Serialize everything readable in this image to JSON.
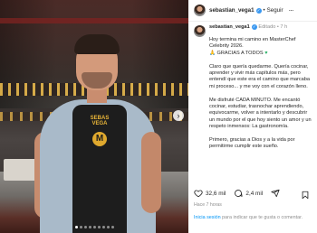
{
  "post": {
    "username": "sebastian_vega1",
    "follow_label": "Seguir",
    "separator": "•",
    "edited_label": "Editado",
    "time_ago": "7 h",
    "apron_text": "SEBAS VEGA",
    "apron_logo": "M",
    "caption": [
      "Hoy termina mi camino en MasterChef Celebrity 2026.",
      "GRACIAS A TODOS",
      "Claro que quería quedarme. Quería cocinar, aprender y vivir más capítulos más, pero entendí que este era el camino que marcaba mi proceso... y me voy con el corazón lleno.",
      "Me disfruté CADA MINUTO. Me encantó cocinar, estudiar, trasnochar aprendiendo, equivocarme, volver a intentarlo y descubrir un mundo por el que hoy siento un amor y un respeto inmensos: La gastronomía.",
      "Primero, gracias a Dios y a la vida por permitirme cumplir este sueño."
    ],
    "likes_count": "32,6 mil",
    "comments_count": "2,4 mil",
    "date": "Hace 7 horas",
    "login_link": "Inicia sesión",
    "login_rest": " para indicar que te gusta o comentar."
  },
  "icons": {
    "verified": "verified-badge-icon",
    "more": "more-options-icon",
    "like": "heart-icon",
    "comment": "comment-bubble-icon",
    "share": "paper-plane-share-icon",
    "save": "bookmark-icon",
    "next": "chevron-right-icon",
    "heart_green": "green-heart-emoji",
    "heart_red": "red-heart-emoji",
    "folded_hands": "folded-hands-emoji"
  },
  "colors": {
    "verified": "#3897f0",
    "link": "#0095f6",
    "muted": "#8e8e8e",
    "text": "#262626"
  },
  "carousel": {
    "total_slides": 9,
    "active_slide": 1
  }
}
